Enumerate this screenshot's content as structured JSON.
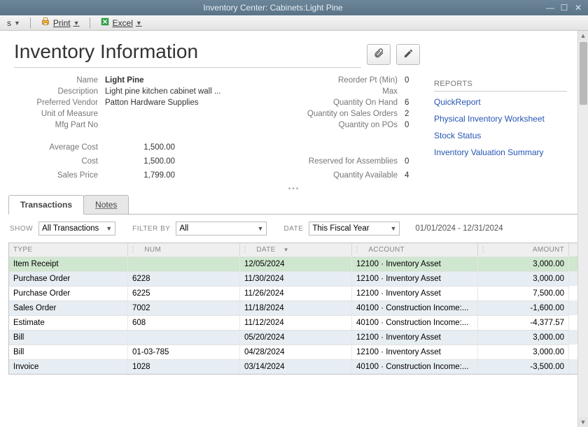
{
  "window": {
    "title": "Inventory Center: Cabinets:Light Pine"
  },
  "toolbar": {
    "first_dropdown_suffix": "s",
    "print": "Print",
    "excel": "Excel"
  },
  "page": {
    "title": "Inventory Information"
  },
  "item": {
    "labels": {
      "name": "Name",
      "description": "Description",
      "preferred_vendor": "Preferred Vendor",
      "uom": "Unit of Measure",
      "mfg": "Mfg Part No",
      "avg_cost": "Average Cost",
      "cost": "Cost",
      "sales_price": "Sales Price"
    },
    "name": "Light Pine",
    "description": "Light pine kitchen cabinet wall ...",
    "preferred_vendor": "Patton Hardware Supplies",
    "uom": "",
    "mfg": "",
    "avg_cost": "1,500.00",
    "cost": "1,500.00",
    "sales_price": "1,799.00"
  },
  "stock": {
    "labels": {
      "reorder": "Reorder Pt (Min)",
      "max": "Max",
      "on_hand": "Quantity On Hand",
      "on_so": "Quantity on Sales Orders",
      "on_po": "Quantity on POs",
      "reserved": "Reserved for Assemblies",
      "available": "Quantity Available"
    },
    "reorder": "0",
    "max": "",
    "on_hand": "6",
    "on_so": "2",
    "on_po": "0",
    "reserved": "0",
    "available": "4"
  },
  "reports": {
    "header": "REPORTS",
    "links": [
      "QuickReport",
      "Physical Inventory Worksheet",
      "Stock Status",
      "Inventory Valuation Summary"
    ]
  },
  "tabs": {
    "transactions": "Transactions",
    "notes": "Notes"
  },
  "filters": {
    "show_label": "SHOW",
    "show_value": "All Transactions",
    "filterby_label": "FILTER BY",
    "filterby_value": "All",
    "date_label": "DATE",
    "date_value": "This Fiscal Year",
    "range": "01/01/2024 - 12/31/2024"
  },
  "grid": {
    "headers": {
      "type": "TYPE",
      "num": "NUM",
      "date": "DATE",
      "account": "ACCOUNT",
      "amount": "AMOUNT"
    },
    "rows": [
      {
        "type": "Item Receipt",
        "num": "",
        "date": "12/05/2024",
        "account": "12100 · Inventory Asset",
        "amount": "3,000.00",
        "sel": true
      },
      {
        "type": "Purchase Order",
        "num": "6228",
        "date": "11/30/2024",
        "account": "12100 · Inventory Asset",
        "amount": "3,000.00",
        "alt": true
      },
      {
        "type": "Purchase Order",
        "num": "6225",
        "date": "11/26/2024",
        "account": "12100 · Inventory Asset",
        "amount": "7,500.00"
      },
      {
        "type": "Sales Order",
        "num": "7002",
        "date": "11/18/2024",
        "account": "40100 · Construction Income:...",
        "amount": "-1,600.00",
        "alt": true
      },
      {
        "type": "Estimate",
        "num": "608",
        "date": "11/12/2024",
        "account": "40100 · Construction Income:...",
        "amount": "-4,377.57"
      },
      {
        "type": "Bill",
        "num": "",
        "date": "05/20/2024",
        "account": "12100 · Inventory Asset",
        "amount": "3,000.00",
        "alt": true
      },
      {
        "type": "Bill",
        "num": "01-03-785",
        "date": "04/28/2024",
        "account": "12100 · Inventory Asset",
        "amount": "3,000.00"
      },
      {
        "type": "Invoice",
        "num": "1028",
        "date": "03/14/2024",
        "account": "40100 · Construction Income:...",
        "amount": "-3,500.00",
        "alt": true
      }
    ]
  }
}
